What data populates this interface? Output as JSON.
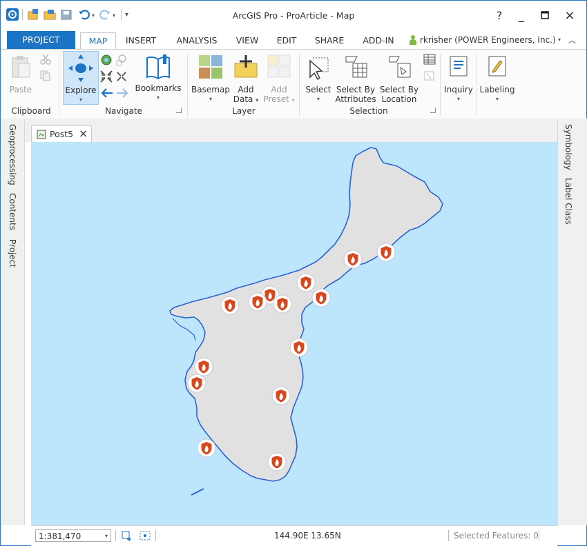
{
  "window": {
    "title": "ArcGIS Pro - ProArticle - Map",
    "help": "?",
    "minimize": "_",
    "close": "×"
  },
  "tabs": {
    "project": "PROJECT",
    "map": "MAP",
    "insert": "INSERT",
    "analysis": "ANALYSIS",
    "view": "VIEW",
    "edit": "EDIT",
    "share": "SHARE",
    "addin": "ADD-IN",
    "user": "rkrisher (POWER Engineers, Inc.)"
  },
  "ribbon": {
    "clipboard": {
      "group": "Clipboard",
      "paste": "Paste"
    },
    "navigate": {
      "group": "Navigate",
      "explore": "Explore",
      "bookmarks": "Bookmarks"
    },
    "layer": {
      "group": "Layer",
      "basemap": "Basemap",
      "add_data_1": "Add",
      "add_data_2": "Data",
      "add_preset_1": "Add",
      "add_preset_2": "Preset"
    },
    "selection": {
      "group": "Selection",
      "select": "Select",
      "by_attr_1": "Select By",
      "by_attr_2": "Attributes",
      "by_loc_1": "Select By",
      "by_loc_2": "Location"
    },
    "inquiry": "Inquiry",
    "labeling": "Labeling"
  },
  "left_panes": [
    "Geoprocessing",
    "Contents",
    "Project"
  ],
  "right_panes": [
    "Symbology",
    "Label Class"
  ],
  "map_view": {
    "tab_label": "Post5",
    "close": "×"
  },
  "status": {
    "scale": "1:381,470",
    "coords": "144.90E 13.65N",
    "selected": "Selected Features: 0"
  },
  "colors": {
    "accent": "#1b74c6",
    "water": "#bde5fb",
    "land": "#e1e1e1",
    "coast": "#2a62d3",
    "marker": "#d7481f"
  },
  "map_markers_icon": "fire-station-shield-icon"
}
